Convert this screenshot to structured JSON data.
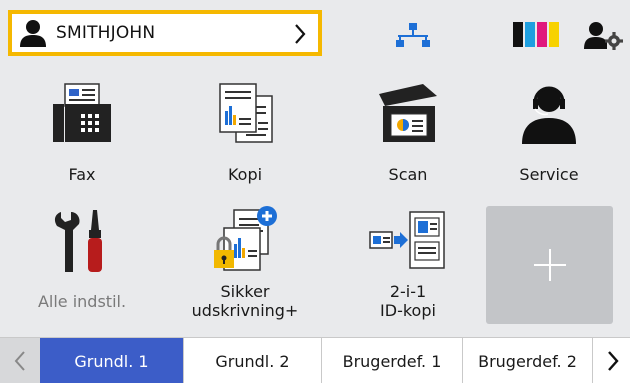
{
  "header": {
    "user_name": "SMITHJOHN",
    "ink_colors": [
      "#111111",
      "#1e9fe0",
      "#e0197d",
      "#f7d200"
    ]
  },
  "tiles": [
    {
      "label": "Fax",
      "icon": "fax-icon"
    },
    {
      "label": "Kopi",
      "icon": "copy-icon"
    },
    {
      "label": "Scan",
      "icon": "scan-icon"
    },
    {
      "label": "Service",
      "icon": "service-icon"
    },
    {
      "label": "Alle indstil.",
      "icon": "settings-tools-icon"
    },
    {
      "label_line1": "Sikker",
      "label_line2": "udskrivning+",
      "icon": "secure-print-icon"
    },
    {
      "label_line1": "2-i-1",
      "label_line2": "ID-kopi",
      "icon": "id-copy-icon"
    }
  ],
  "add_tile": {
    "icon": "plus-icon"
  },
  "tabs": [
    {
      "label": "Grundl. 1",
      "active": true
    },
    {
      "label": "Grundl. 2",
      "active": false
    },
    {
      "label": "Brugerdef. 1",
      "active": false
    },
    {
      "label": "Brugerdef. 2",
      "active": false
    }
  ],
  "colors": {
    "highlight_border": "#f5b800",
    "active_tab": "#3c5dc8",
    "background": "#e9eaec"
  }
}
